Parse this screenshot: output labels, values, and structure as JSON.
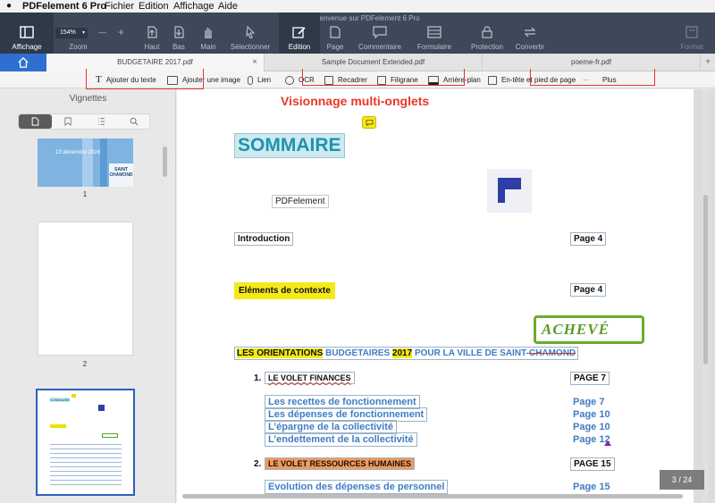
{
  "menubar": {
    "apple": "",
    "app_name": "PDFelement 6 Pro",
    "items": [
      "Fichier",
      "Edition",
      "Affichage",
      "Aide"
    ]
  },
  "window_title": "Bienvenue sur PDFelement 6 Pro",
  "toolbar": {
    "affichage": "Affichage",
    "zoom_value": "154%",
    "zoom_label": "Zoom",
    "minus": "—",
    "plus": "+",
    "haut": "Haut",
    "bas": "Bas",
    "main": "Main",
    "selectionner": "Sélectionner",
    "edition": "Edition",
    "page": "Page",
    "commentaire": "Commentaire",
    "formulaire": "Formulaire",
    "protection": "Protection",
    "convertir": "Convertir",
    "format": "Format"
  },
  "tabs": [
    {
      "label": "BUDGETAIRE 2017.pdf"
    },
    {
      "label": "Sample Document Extended.pdf"
    },
    {
      "label": "poeme-fr.pdf"
    }
  ],
  "tab_close": "×",
  "edit_tools": {
    "ajouter_texte": "Ajouter du texte",
    "ajouter_image": "Ajouter une image",
    "lien": "Lien",
    "ocr": "OCR",
    "recadrer": "Recadrer",
    "filigrane": "Filigrane",
    "arriere_plan": "Arrière-plan",
    "entete": "En-tête et pied de page",
    "dots": "···",
    "plus": "Plus"
  },
  "sidebar": {
    "title": "Vignettes",
    "thumbs": [
      {
        "label": "1",
        "date": "13 décembre 2016",
        "logo": "SAINT CHAMOND"
      },
      {
        "label": "2"
      },
      {
        "label": "",
        "mini_title": "SOMMAIRE"
      }
    ]
  },
  "annotation": "Visionnage multi-onglets",
  "document": {
    "sommaire": "SOMMAIRE",
    "pdfelement": "PDFelement",
    "introduction": "Introduction",
    "intro_page": "Page 4",
    "elements": "Eléments de contexte",
    "elements_page": "Page 4",
    "stamp": "ACHEVÉ",
    "orient_1": "LES ORIENTATIONS",
    "orient_2": "BUDGETAIRES",
    "orient_3": "2017",
    "orient_4": "POUR LA VILLE DE SAINT-",
    "orient_5": "CHAMOND",
    "sec1_num": "1.",
    "sec1_title": "LE VOLET FINANCES",
    "sec1_page": "PAGE 7",
    "items": [
      {
        "text": "Les recettes de fonctionnement",
        "page": "Page 7"
      },
      {
        "text": "Les dépenses de fonctionnement",
        "page": "Page 10"
      },
      {
        "text": "L’épargne de la collectivité",
        "page": "Page 10"
      },
      {
        "text": "L’endettement de la collectivité",
        "page": "Page 12"
      }
    ],
    "sec2_num": "2.",
    "sec2_title": "LE VOLET RESSOURCES HUMAINES",
    "sec2_page": "PAGE 15",
    "last_item": "Evolution des dépenses de personnel",
    "last_page": "Page 15"
  },
  "page_counter": "3 / 24"
}
